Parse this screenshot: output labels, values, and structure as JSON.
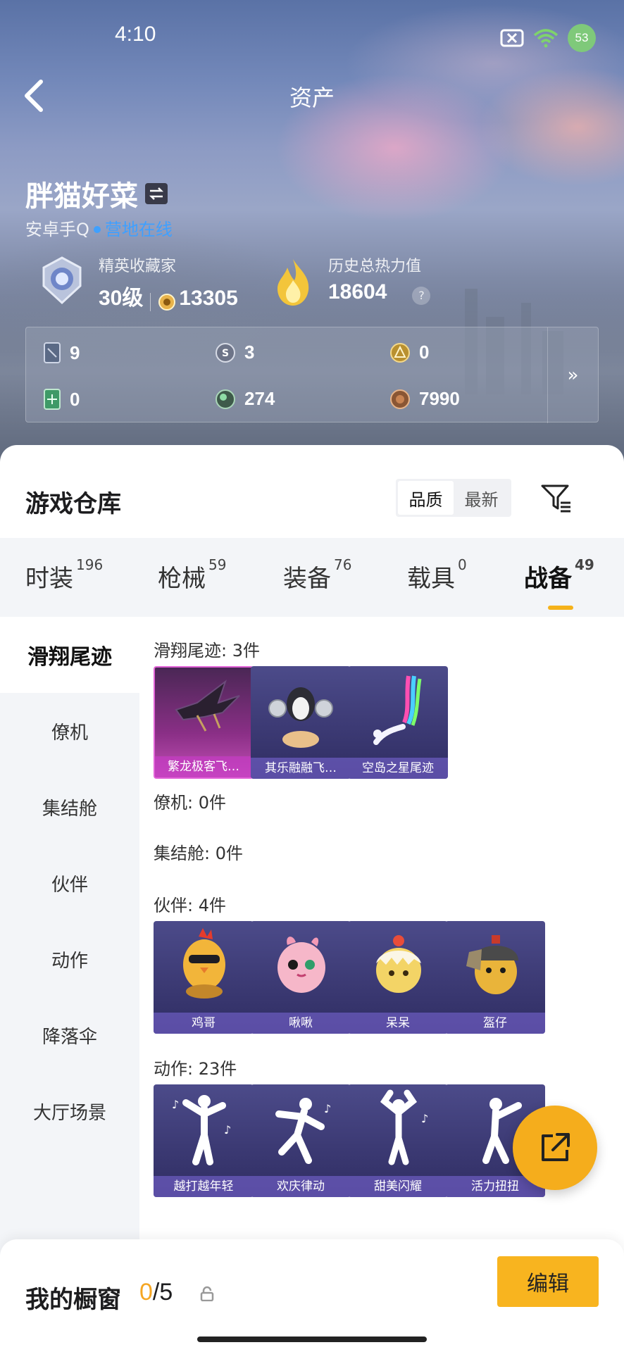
{
  "status_bar": {
    "time": "4:10",
    "battery": "53"
  },
  "header": {
    "title": "资产"
  },
  "profile": {
    "name": "胖猫好菜",
    "platform": "安卓手Q",
    "online_status": "营地在线",
    "collector_title": "精英收藏家",
    "collector_level": "30级",
    "collector_points": "13305",
    "heat_label": "历史总热力值",
    "heat_value": "18604",
    "heat_help": "?"
  },
  "currencies": [
    {
      "icon": "card-icon",
      "value": "9"
    },
    {
      "icon": "silver-coin-icon",
      "value": "3"
    },
    {
      "icon": "gold-coin-icon",
      "value": "0"
    },
    {
      "icon": "green-ticket-icon",
      "value": "0"
    },
    {
      "icon": "green-orb-icon",
      "value": "274"
    },
    {
      "icon": "bronze-coin-icon",
      "value": "7990"
    }
  ],
  "currency_more": "»",
  "warehouse": {
    "title": "游戏仓库",
    "sort_options": [
      "品质",
      "最新"
    ],
    "sort_selected": "品质"
  },
  "tabs": [
    {
      "label": "时装",
      "count": "196"
    },
    {
      "label": "枪械",
      "count": "59"
    },
    {
      "label": "装备",
      "count": "76"
    },
    {
      "label": "载具",
      "count": "0"
    },
    {
      "label": "战备",
      "count": "49",
      "active": true
    }
  ],
  "sidebar": [
    {
      "label": "滑翔尾迹",
      "active": true
    },
    {
      "label": "僚机"
    },
    {
      "label": "集结舱"
    },
    {
      "label": "伙伴"
    },
    {
      "label": "动作"
    },
    {
      "label": "降落伞"
    },
    {
      "label": "大厅场景"
    }
  ],
  "sections": {
    "glide": {
      "title": "滑翔尾迹: 3件",
      "items": [
        "繁龙极客飞…",
        "其乐融融飞…",
        "空岛之星尾迹"
      ]
    },
    "wingman": {
      "title": "僚机: 0件"
    },
    "capsule": {
      "title": "集结舱: 0件"
    },
    "partner": {
      "title": "伙伴: 4件",
      "items": [
        "鸡哥",
        "啾啾",
        "呆呆",
        "盔仔"
      ]
    },
    "action": {
      "title": "动作: 23件",
      "items": [
        "越打越年轻",
        "欢庆律动",
        "甜美闪耀",
        "活力扭扭"
      ]
    }
  },
  "bottom": {
    "showcase_label": "我的橱窗",
    "count_current": "0",
    "count_total": "/5",
    "edit_label": "编辑"
  },
  "colors": {
    "accent": "#f5b21a",
    "online": "#3fa0ff",
    "glide_highlight": "#e264d8",
    "card_bg": "#3c3a74"
  }
}
